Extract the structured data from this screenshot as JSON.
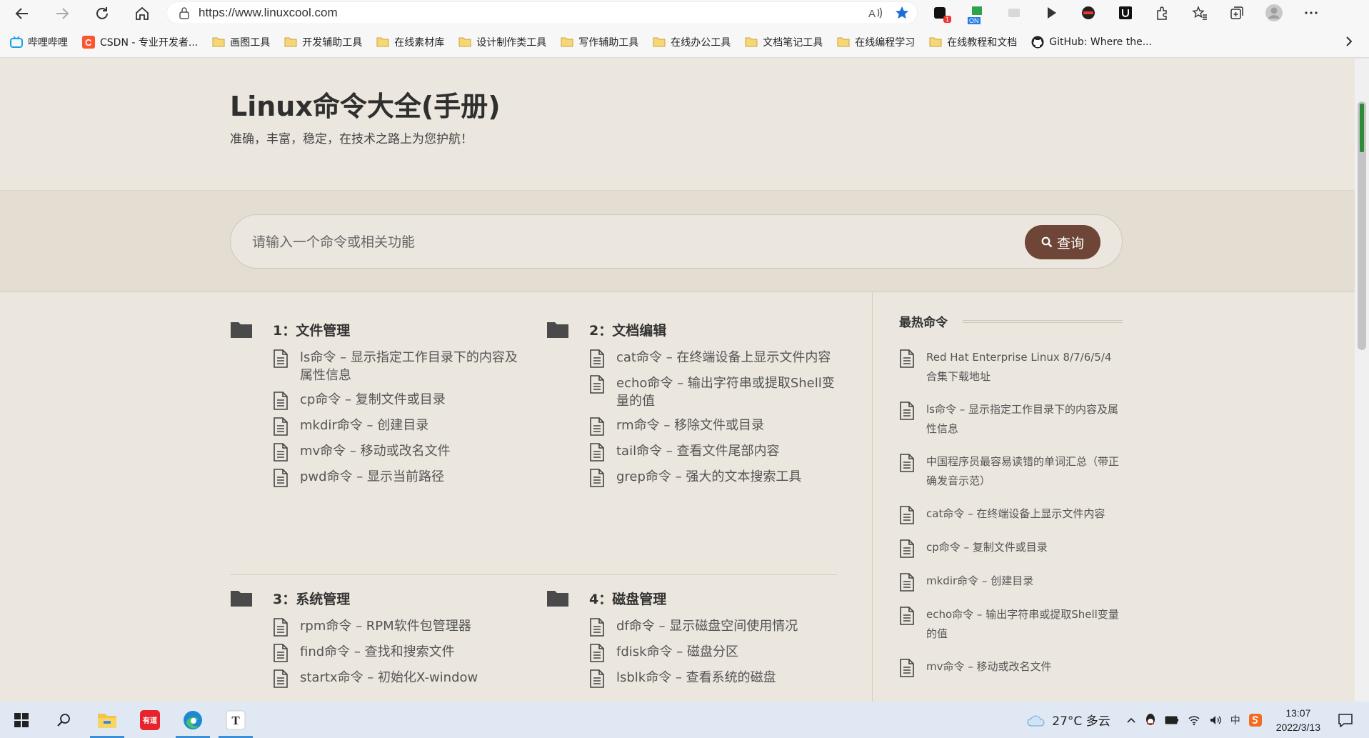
{
  "browser": {
    "url": "https://www.linuxcool.com",
    "bookmarks": [
      {
        "label": "哔哩哔哩",
        "icon": "bilibili-icon"
      },
      {
        "label": "CSDN - 专业开发者...",
        "icon": "csdn-icon"
      },
      {
        "label": "画图工具",
        "icon": "folder-icon"
      },
      {
        "label": "开发辅助工具",
        "icon": "folder-icon"
      },
      {
        "label": "在线素材库",
        "icon": "folder-icon"
      },
      {
        "label": "设计制作类工具",
        "icon": "folder-icon"
      },
      {
        "label": "写作辅助工具",
        "icon": "folder-icon"
      },
      {
        "label": "在线办公工具",
        "icon": "folder-icon"
      },
      {
        "label": "文档笔记工具",
        "icon": "folder-icon"
      },
      {
        "label": "在线编程学习",
        "icon": "folder-icon"
      },
      {
        "label": "在线教程和文档",
        "icon": "folder-icon"
      },
      {
        "label": "GitHub: Where the...",
        "icon": "github-icon"
      }
    ],
    "extension_badge": "1",
    "extension_on_label": "ON"
  },
  "site": {
    "title": "Linux命令大全(手册)",
    "subtitle": "准确，丰富，稳定，在技术之路上为您护航！"
  },
  "search": {
    "placeholder": "请输入一个命令或相关功能",
    "button_label": "查询"
  },
  "categories": [
    {
      "title": "1：文件管理",
      "items": [
        "ls命令 – 显示指定工作目录下的内容及属性信息",
        "cp命令 – 复制文件或目录",
        "mkdir命令 – 创建目录",
        "mv命令 – 移动或改名文件",
        "pwd命令 – 显示当前路径"
      ]
    },
    {
      "title": "2：文档编辑",
      "items": [
        "cat命令 – 在终端设备上显示文件内容",
        "echo命令 – 输出字符串或提取Shell变量的值",
        "rm命令 – 移除文件或目录",
        "tail命令 – 查看文件尾部内容",
        "grep命令 – 强大的文本搜索工具"
      ]
    },
    {
      "title": "3：系统管理",
      "items": [
        "rpm命令 – RPM软件包管理器",
        "find命令 – 查找和搜索文件",
        "startx命令 – 初始化X-window"
      ]
    },
    {
      "title": "4：磁盘管理",
      "items": [
        "df命令 – 显示磁盘空间使用情况",
        "fdisk命令 – 磁盘分区",
        "lsblk命令 – 查看系统的磁盘"
      ]
    }
  ],
  "sidebar": {
    "title": "最热命令",
    "items": [
      "Red Hat Enterprise Linux 8/7/6/5/4 合集下载地址",
      "ls命令 – 显示指定工作目录下的内容及属性信息",
      "中国程序员最容易读错的单词汇总（带正确发音示范）",
      "cat命令 – 在终端设备上显示文件内容",
      "cp命令 – 复制文件或目录",
      "mkdir命令 – 创建目录",
      "echo命令 – 输出字符串或提取Shell变量的值",
      "mv命令 – 移动或改名文件"
    ]
  },
  "taskbar": {
    "weather": "27°C 多云",
    "time": "13:07",
    "date": "2022/3/13",
    "youdao_label": "有道",
    "typora_label": "T",
    "ime_label": "中"
  },
  "colors": {
    "accent": "#6e4536",
    "page_bg": "#ebe6de",
    "search_band": "#e4ddd2"
  }
}
